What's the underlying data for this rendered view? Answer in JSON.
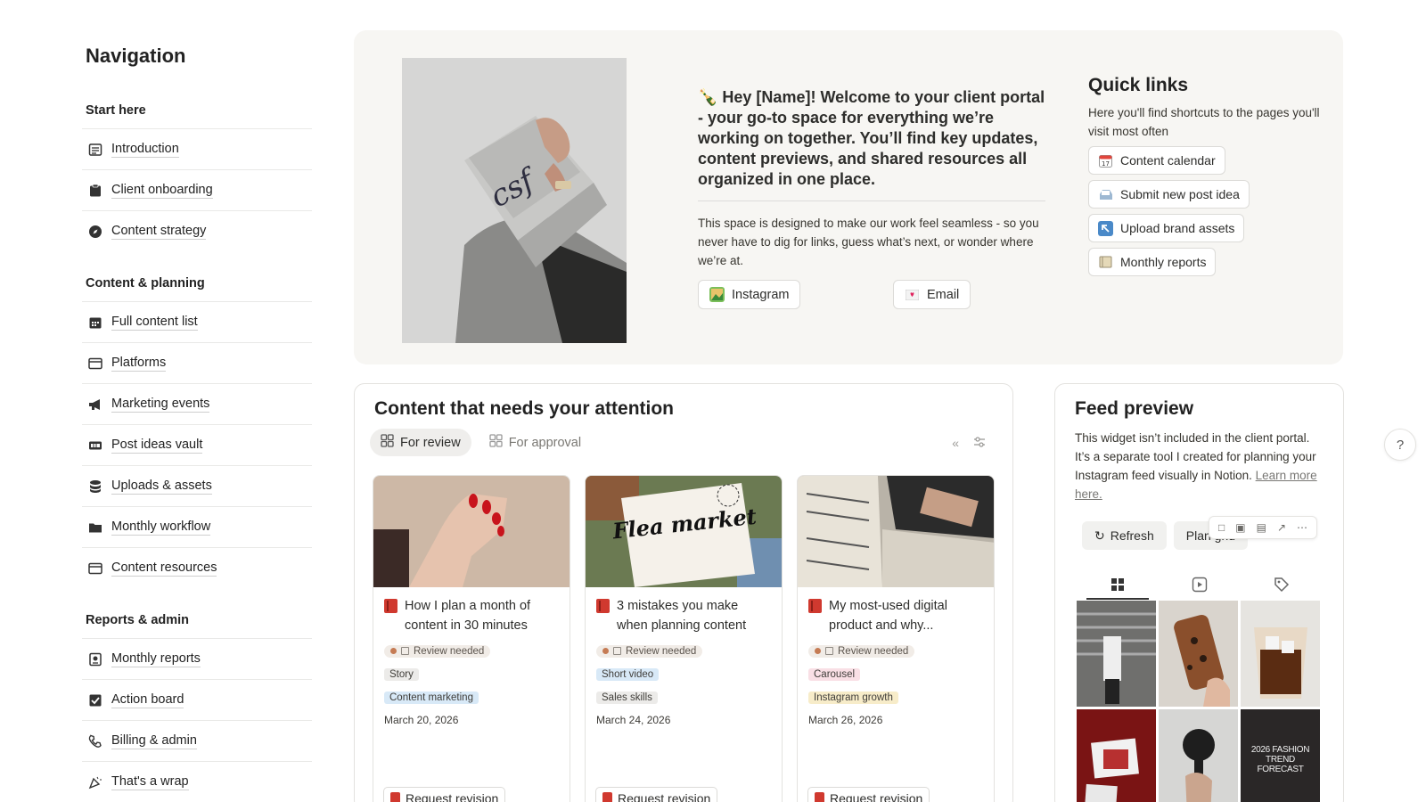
{
  "sidebar": {
    "title": "Navigation",
    "sections": [
      {
        "label": "Start here",
        "items": [
          "Introduction",
          "Client onboarding",
          "Content strategy"
        ]
      },
      {
        "label": "Content & planning",
        "items": [
          "Full content list",
          "Platforms",
          "Marketing events",
          "Post ideas vault",
          "Uploads & assets",
          "Monthly workflow",
          "Content resources"
        ]
      },
      {
        "label": "Reports & admin",
        "items": [
          "Monthly reports",
          "Action board",
          "Billing & admin",
          "That's a wrap"
        ]
      }
    ]
  },
  "hero": {
    "headline": "🍾 Hey [Name]! Welcome to your client portal - your go-to space for everything we’re working on together. You’ll find key updates, content previews, and shared resources all organized in one place.",
    "body": "This space is designed to make our work feel seamless - so you never have to dig for links, guess what’s next, or wonder where we’re at.",
    "buttons": {
      "instagram": "Instagram",
      "email": "Email"
    },
    "photo_text": "csf"
  },
  "quick_links": {
    "title": "Quick links",
    "description": "Here you'll find shortcuts to the pages you'll visit most often",
    "links": [
      "Content calendar",
      "Submit new post idea",
      "Upload brand assets",
      "Monthly reports"
    ]
  },
  "attention": {
    "title": "Content that needs your attention",
    "tabs": [
      "For review",
      "For approval"
    ],
    "cards": [
      {
        "title": "How I plan a month of content in 30 minutes",
        "status": "Review needed",
        "tags": [
          {
            "label": "Story",
            "color": "#ecebe9"
          },
          {
            "label": "Content marketing",
            "color": "#d8e9f7"
          }
        ],
        "date": "March 20, 2026",
        "action": "Request revision"
      },
      {
        "title": "3 mistakes you make when planning content",
        "status": "Review needed",
        "tags": [
          {
            "label": "Short video",
            "color": "#d8e9f7"
          },
          {
            "label": "Sales skills",
            "color": "#ecebe9"
          }
        ],
        "date": "March 24, 2026",
        "action": "Request revision",
        "image_text": "Flea market"
      },
      {
        "title": "My most-used digital product and why...",
        "status": "Review needed",
        "tags": [
          {
            "label": "Carousel",
            "color": "#f9dfe5"
          },
          {
            "label": "Instagram growth",
            "color": "#f7ecc9"
          }
        ],
        "date": "March 26, 2026",
        "action": "Request revision"
      }
    ]
  },
  "feed": {
    "title": "Feed preview",
    "description": "This widget isn’t included in the client portal. It’s a separate tool I created for planning your Instagram feed visually in Notion.",
    "learn_more": "Learn more here.",
    "refresh": "Refresh",
    "plan_grid": "Plan grid",
    "grid_text": "2026 FASHION TREND FORECAST"
  },
  "help": "?"
}
